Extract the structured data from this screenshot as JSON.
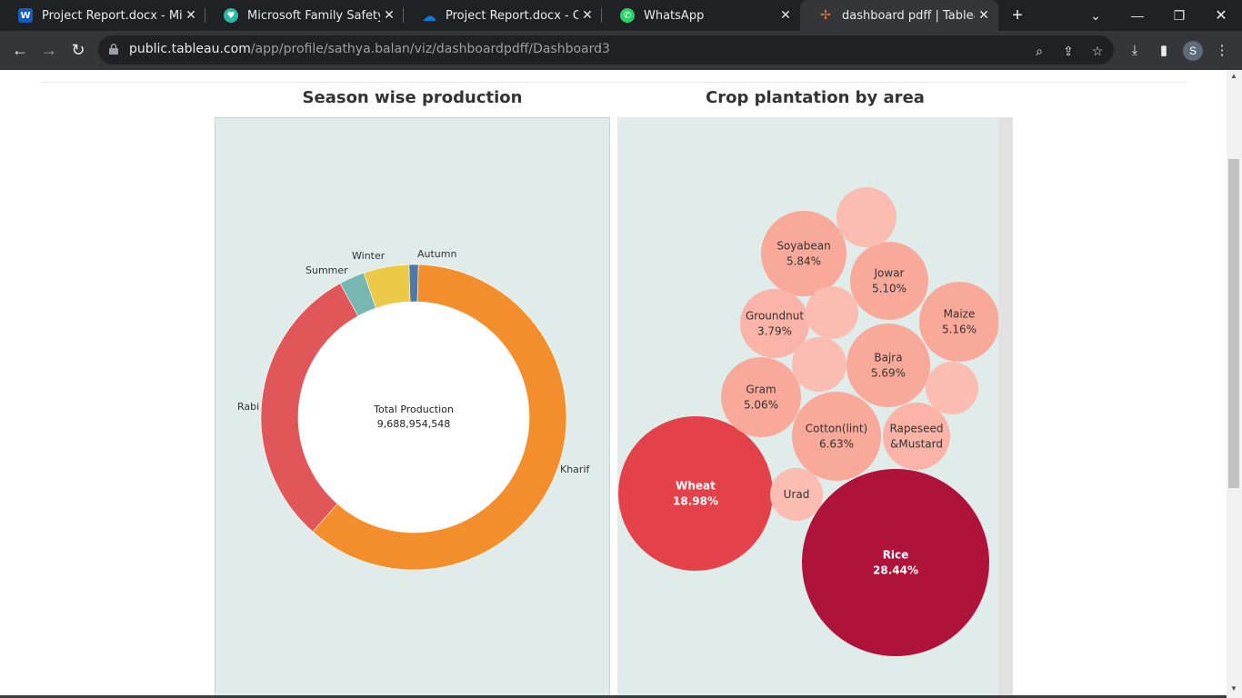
{
  "tabs": [
    {
      "title": "Project Report.docx - Micros",
      "icon": "word-icon",
      "color": "#185abd",
      "glyph": "W"
    },
    {
      "title": "Microsoft Family Safety",
      "icon": "heart-icon",
      "color": "#2bb9a9",
      "glyph": "♥"
    },
    {
      "title": "Project Report.docx - OneDr",
      "icon": "onedrive-icon",
      "color": "#0f78d4",
      "glyph": "☁"
    },
    {
      "title": "WhatsApp",
      "icon": "whatsapp-icon",
      "color": "#25d366",
      "glyph": "✆"
    },
    {
      "title": "dashboard pdff | Tableau Pu",
      "icon": "tableau-icon",
      "color": "#e8762d",
      "glyph": "✢"
    }
  ],
  "address": {
    "host": "public.tableau.com",
    "path": "/app/profile/sathya.balan/viz/dashboardpdff/Dashboard3"
  },
  "profile_initial": "S",
  "dashboard": {
    "season_title": "Season wise production",
    "crop_title": "Crop plantation by area",
    "center_label": "Total Production",
    "center_value": "9,688,954,548"
  },
  "chart_data": [
    {
      "type": "pie",
      "title": "Season wise production",
      "categories": [
        "Autumn",
        "Kharif",
        "Rabi",
        "Summer",
        "Winter"
      ],
      "values": [
        1.0,
        61.0,
        30.5,
        2.7,
        4.8
      ],
      "colors": [
        "#4e79a7",
        "#f28e2b",
        "#e15759",
        "#76b7b2",
        "#edc948"
      ],
      "center_text": [
        "Total Production",
        "9,688,954,548"
      ]
    },
    {
      "type": "bubble",
      "title": "Crop plantation by area",
      "bubbles": [
        {
          "name": "Rice",
          "value": "28.44%",
          "color": "#b0133a",
          "text_color": "#ffffff"
        },
        {
          "name": "Wheat",
          "value": "18.98%",
          "color": "#e3424a",
          "text_color": "#ffffff"
        },
        {
          "name": "Cotton(lint)",
          "value": "6.63%",
          "color": "#f9a99a",
          "text_color": "#333333"
        },
        {
          "name": "Soyabean",
          "value": "5.84%",
          "color": "#f9a99a",
          "text_color": "#333333"
        },
        {
          "name": "Bajra",
          "value": "5.69%",
          "color": "#f9a99a",
          "text_color": "#333333"
        },
        {
          "name": "Maize",
          "value": "5.16%",
          "color": "#f9a99a",
          "text_color": "#333333"
        },
        {
          "name": "Jowar",
          "value": "5.10%",
          "color": "#f9a99a",
          "text_color": "#333333"
        },
        {
          "name": "Gram",
          "value": "5.06%",
          "color": "#f9a99a",
          "text_color": "#333333"
        },
        {
          "name": "Groundnut",
          "value": "3.79%",
          "color": "#fab4a7",
          "text_color": "#333333"
        },
        {
          "name": "Rapeseed &Mustard",
          "value": "",
          "color": "#fab4a7",
          "text_color": "#333333"
        },
        {
          "name": "Urad",
          "value": "",
          "color": "#fbbcb1",
          "text_color": "#333333"
        },
        {
          "name": "",
          "value": "",
          "color": "#fbbcb1",
          "text_color": "#333333"
        },
        {
          "name": "",
          "value": "",
          "color": "#fbbcb1",
          "text_color": "#333333"
        },
        {
          "name": "",
          "value": "",
          "color": "#fbbcb1",
          "text_color": "#333333"
        },
        {
          "name": "",
          "value": "",
          "color": "#fbbcb1",
          "text_color": "#333333"
        }
      ]
    }
  ]
}
